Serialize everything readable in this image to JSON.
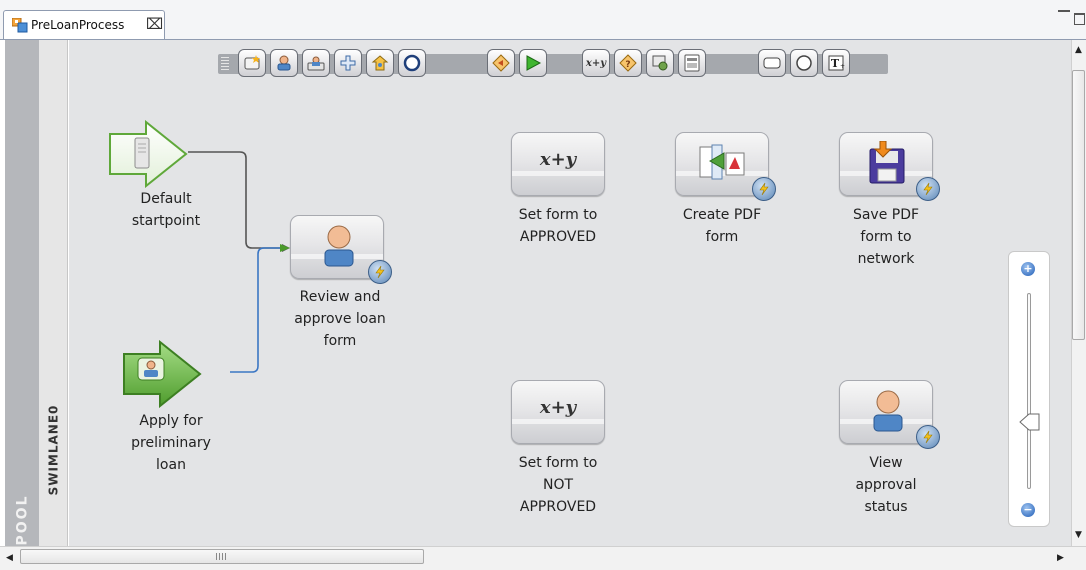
{
  "tab": {
    "title": "PreLoanProcess",
    "close_glyph": "⌧"
  },
  "pool": {
    "label": "POOL"
  },
  "swimlane": {
    "label": "SWIMLANE0"
  },
  "toolbar": {
    "tools": [
      {
        "name": "new-activity-icon"
      },
      {
        "name": "user-task-icon"
      },
      {
        "name": "subprocess-icon"
      },
      {
        "name": "add-icon"
      },
      {
        "name": "start-point-icon"
      },
      {
        "name": "event-icon"
      },
      {
        "name": "gateway-icon"
      },
      {
        "name": "go-icon"
      },
      {
        "name": "set-value-icon",
        "text": "x+y"
      },
      {
        "name": "decision-icon"
      },
      {
        "name": "service-icon"
      },
      {
        "name": "form-icon"
      },
      {
        "name": "lane-icon"
      },
      {
        "name": "end-event-icon"
      },
      {
        "name": "text-annotation-icon"
      }
    ]
  },
  "nodes": {
    "default_start": {
      "label": "Default\nstartpoint"
    },
    "apply_start": {
      "label": "Apply for\npreliminary\nloan"
    },
    "review": {
      "label": "Review and\napprove loan\nform"
    },
    "set_approved": {
      "label": "Set form to\nAPPROVED",
      "symbol": "x+y"
    },
    "set_not_approved": {
      "label": "Set form to\nNOT\nAPPROVED",
      "symbol": "x+y"
    },
    "create_pdf": {
      "label": "Create PDF\nform"
    },
    "save_pdf": {
      "label": "Save PDF\nform to\nnetwork"
    },
    "view_status": {
      "label": "View\napproval\nstatus"
    }
  },
  "colors": {
    "canvas": "#e3e4e6",
    "start_green": "#5fa83a",
    "connector_dark": "#555555",
    "connector_blue": "#3b76c4"
  },
  "zoom": {
    "plus": "+",
    "minus": "−"
  }
}
